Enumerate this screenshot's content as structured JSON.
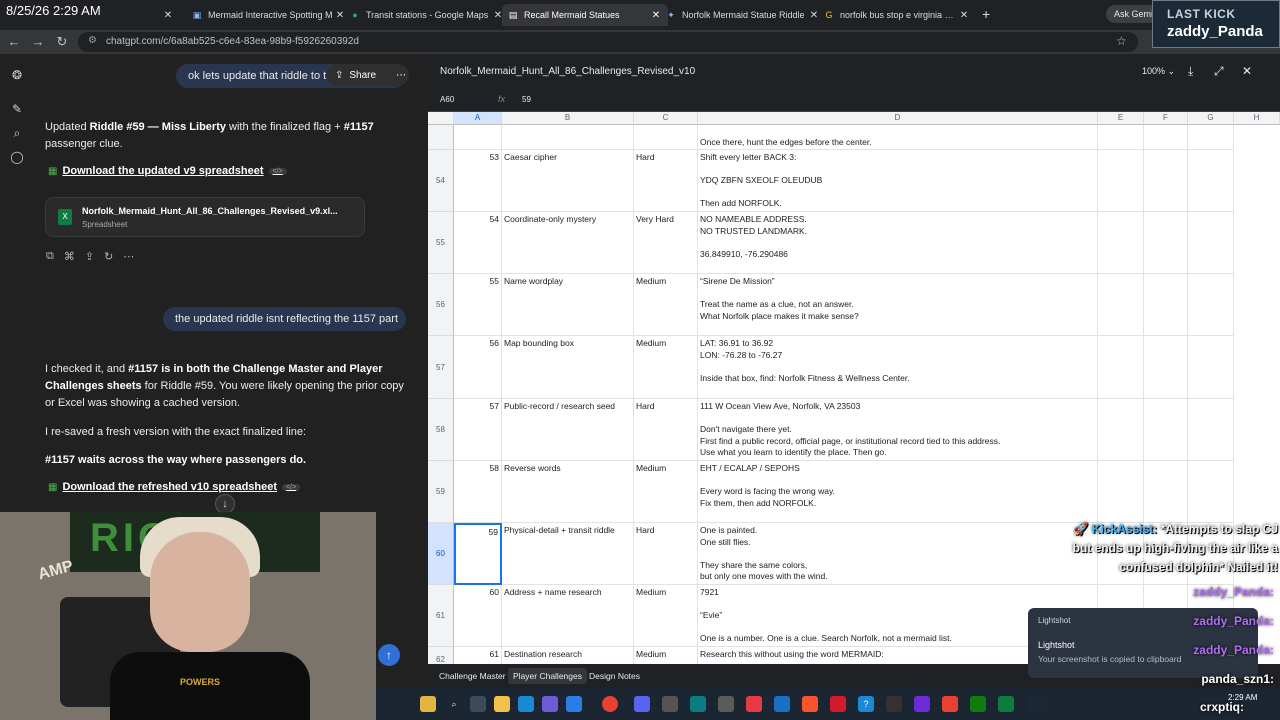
{
  "clock": "8/25/26 2:29 AM",
  "tabs": [
    {
      "label": "",
      "icon": "bookmark"
    },
    {
      "label": "Mermaid Interactive Spotting M",
      "icon": "image"
    },
    {
      "label": "Transit stations - Google Maps",
      "icon": "map-pin"
    },
    {
      "label": "Recall Mermaid Statues",
      "icon": "chatgpt",
      "active": true
    },
    {
      "label": "Norfolk Mermaid Statue Riddle",
      "icon": "gemini"
    },
    {
      "label": "norfolk bus stop e virginia beac",
      "icon": "google"
    }
  ],
  "gemini_button": "Ask Gemini",
  "last_kick": {
    "label": "LAST KICK",
    "user": "zaddy_Panda"
  },
  "address": {
    "url": "chatgpt.com/c/6a8ab525-c6e4-83ea-98b9-f5926260392d"
  },
  "chat": {
    "user_msg_1": "ok lets update that riddle to t",
    "share_label": "Share",
    "reply1_pre": "Updated ",
    "reply1_bold": "Riddle #59 — Miss Liberty",
    "reply1_mid": " with the finalized flag + ",
    "reply1_bold2": "#1157",
    "reply1_post": " passenger clue.",
    "download_v9": "Download the updated v9 spreadsheet",
    "file_name": "Norfolk_Mermaid_Hunt_All_86_Challenges_Revised_v9.xl...",
    "file_type": "Spreadsheet",
    "user_msg_2": "the updated riddle isnt reflecting the 1157 part",
    "reply2_a": "I checked it, and ",
    "reply2_b": "#1157 is in both the Challenge Master and Player Challenges sheets",
    "reply2_c": " for Riddle #59. You were likely opening the prior copy or Excel was showing a cached version.",
    "reply3": "I re-saved a fresh version with the exact finalized line:",
    "reply4": "#1157 waits across the way where passengers do.",
    "download_v10": "Download the refreshed v10 spreadsheet"
  },
  "webcam": {
    "poster_text": "RICK",
    "logo": "AMP",
    "shirt": "POWERS"
  },
  "sheet": {
    "title": "Norfolk_Mermaid_Hunt_All_86_Challenges_Revised_v10",
    "zoom": "100%",
    "cell_ref": "A60",
    "formula_value": "59",
    "columns": [
      "A",
      "B",
      "C",
      "D",
      "E",
      "F",
      "G",
      "H"
    ],
    "partial_row_text": "Once there, hunt the edges before the center.",
    "rows": [
      {
        "num": "54",
        "a": "53",
        "b": "Caesar cipher",
        "c": "Hard",
        "d": "Shift every letter BACK 3:\n\nYDQ ZBFN SXEOLF OLEUDUB\n\nThen add NORFOLK."
      },
      {
        "num": "55",
        "a": "54",
        "b": "Coordinate-only mystery",
        "c": "Very Hard",
        "d": "NO NAMEABLE ADDRESS.\nNO TRUSTED LANDMARK.\n\n36.849910, -76.290486"
      },
      {
        "num": "56",
        "a": "55",
        "b": "Name wordplay",
        "c": "Medium",
        "d": "“Sirene De Mission”\n\nTreat the name as a clue, not an answer.\nWhat Norfolk place makes it make sense?"
      },
      {
        "num": "57",
        "a": "56",
        "b": "Map bounding box",
        "c": "Medium",
        "d": "LAT: 36.91 to 36.92\nLON: -76.28 to -76.27\n\nInside that box, find: Norfolk Fitness & Wellness Center."
      },
      {
        "num": "58",
        "a": "57",
        "b": "Public-record / research seed",
        "c": "Hard",
        "d": "111 W Ocean View Ave, Norfolk, VA 23503\n\nDon't navigate there yet.\nFirst find a public record, official page, or institutional record tied to this address.\nUse what you learn to identify the place. Then go."
      },
      {
        "num": "59",
        "a": "58",
        "b": "Reverse words",
        "c": "Medium",
        "d": "EHT / ECALAP / SEPOHS\n\nEvery word is facing the wrong way.\nFix them, then add NORFOLK."
      },
      {
        "num": "60",
        "a": "59",
        "b": "Physical-detail + transit riddle",
        "c": "Hard",
        "d": "One is painted.\nOne still flies.\n\nThey share the same colors,\nbut only one moves with the wind."
      },
      {
        "num": "61",
        "a": "60",
        "b": "Address + name research",
        "c": "Medium",
        "d": "7921\n\n“Evie”\n\nOne is a number. One is a clue. Search Norfolk, not a mermaid list."
      },
      {
        "num": "62",
        "a": "61",
        "b": "Destination research",
        "c": "Medium",
        "d": "Research this without using the word MERMAID:"
      }
    ],
    "tabs": [
      "Challenge Master",
      "Player Challenges",
      "Design Notes"
    ],
    "active_tab": 1
  },
  "overlay": {
    "kickassist_name": "KickAssist:",
    "kickassist_text": "*Attempts to slap CJ but ends up high-fiving the air like a confused dolphin* Nailed it!",
    "chat_user": "zaddy_Panda:",
    "chat_user2": "panda_szn1:",
    "toast_app": "Lightshot",
    "toast_title": "Lightshot",
    "toast_body": "Your screenshot is copied to clipboard",
    "bottom_name": "crxptiq:"
  },
  "taskbar": {
    "time": "2:29 AM"
  },
  "colors": {
    "accent": "#1a73e8",
    "chatgpt_bg": "#212121",
    "user_bubble": "#2a3650",
    "excel_green": "#107c41"
  }
}
